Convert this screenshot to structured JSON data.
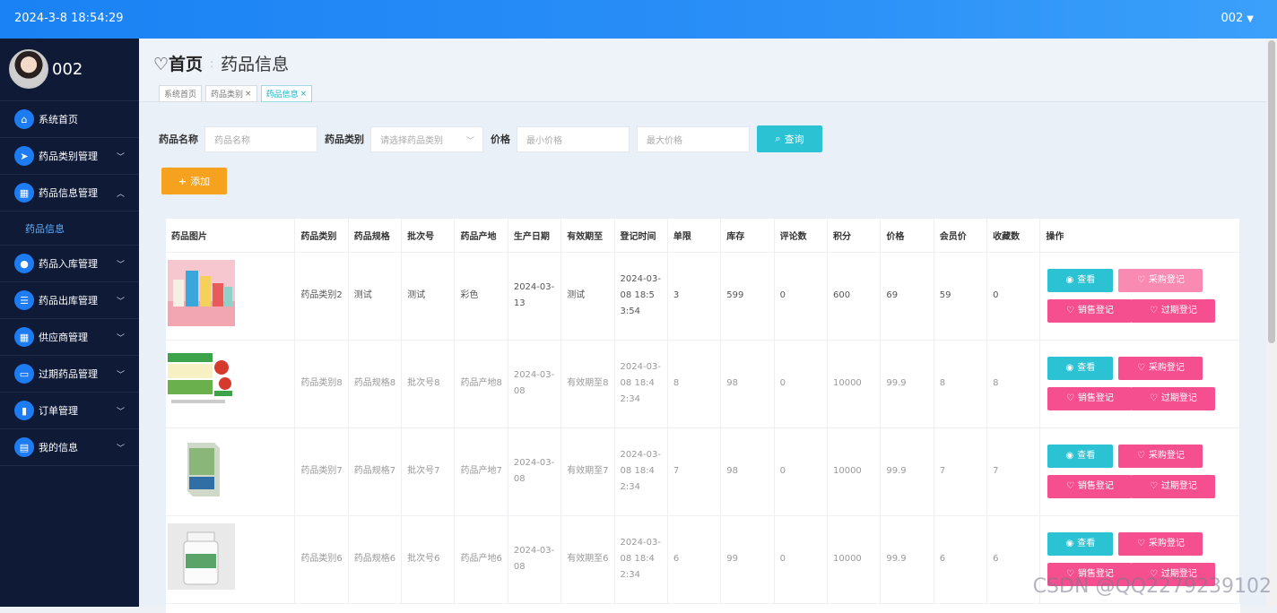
{
  "topbar": {
    "time": "2024-3-8 18:54:29",
    "user": "002"
  },
  "sidebar": {
    "username": "002",
    "items": [
      {
        "label": "系统首页",
        "icon": "home-icon",
        "glyph": "⌂",
        "chevron": ""
      },
      {
        "label": "药品类别管理",
        "icon": "send-icon",
        "glyph": "➤",
        "chevron": "﹀"
      },
      {
        "label": "药品信息管理",
        "icon": "grid-icon",
        "glyph": "▦",
        "chevron": "︿"
      },
      {
        "label": "药品入库管理",
        "icon": "pin-icon",
        "glyph": "●",
        "chevron": "﹀"
      },
      {
        "label": "药品出库管理",
        "icon": "sliders-icon",
        "glyph": "☰",
        "chevron": "﹀"
      },
      {
        "label": "供应商管理",
        "icon": "apps-icon",
        "glyph": "▦",
        "chevron": "﹀"
      },
      {
        "label": "过期药品管理",
        "icon": "monitor-icon",
        "glyph": "▭",
        "chevron": "﹀"
      },
      {
        "label": "订单管理",
        "icon": "chart-icon",
        "glyph": "▮",
        "chevron": "﹀"
      },
      {
        "label": "我的信息",
        "icon": "card-icon",
        "glyph": "▤",
        "chevron": "﹀"
      }
    ],
    "submenu": "药品信息"
  },
  "header": {
    "home": "首页",
    "current": "药品信息"
  },
  "tabs": [
    {
      "label": "系统首页",
      "closable": false
    },
    {
      "label": "药品类别",
      "closable": true
    },
    {
      "label": "药品信息",
      "closable": true
    }
  ],
  "search": {
    "name_label": "药品名称",
    "name_placeholder": "药品名称",
    "category_label": "药品类别",
    "category_placeholder": "请选择药品类别",
    "price_label": "价格",
    "min_placeholder": "最小价格",
    "max_placeholder": "最大价格",
    "button": "查询"
  },
  "add_button": "添加",
  "table": {
    "headers": [
      "药品图片",
      "药品类别",
      "药品规格",
      "批次号",
      "药品产地",
      "生产日期",
      "有效期至",
      "登记时间",
      "单限",
      "库存",
      "评论数",
      "积分",
      "价格",
      "会员价",
      "收藏数",
      "操作"
    ],
    "rows": [
      {
        "image": "product-box-photo",
        "category": "药品类别2",
        "spec": "测试",
        "batch": "测试",
        "origin": "彩色",
        "prod_date": "2024-03-13",
        "expiry": "测试",
        "reg_time": "2024-03-08 18:53:54",
        "limit": "3",
        "stock": "599",
        "comments": "0",
        "points": "600",
        "price": "69",
        "member_price": "59",
        "favorites": "0"
      },
      {
        "image": "weixiao-tablets-box",
        "category": "药品类别8",
        "spec": "药品规格8",
        "batch": "批次号8",
        "origin": "药品产地8",
        "prod_date": "2024-03-08",
        "expiry": "有效期至8",
        "reg_time": "2024-03-08 18:42:34",
        "limit": "8",
        "stock": "98",
        "comments": "0",
        "points": "10000",
        "price": "99.9",
        "member_price": "8",
        "favorites": "8"
      },
      {
        "image": "green-medicine-box",
        "category": "药品类别7",
        "spec": "药品规格7",
        "batch": "批次号7",
        "origin": "药品产地7",
        "prod_date": "2024-03-08",
        "expiry": "有效期至7",
        "reg_time": "2024-03-08 18:42:34",
        "limit": "7",
        "stock": "98",
        "comments": "0",
        "points": "10000",
        "price": "99.9",
        "member_price": "7",
        "favorites": "7"
      },
      {
        "image": "white-pill-bottle",
        "category": "药品类别6",
        "spec": "药品规格6",
        "batch": "批次号6",
        "origin": "药品产地6",
        "prod_date": "2024-03-08",
        "expiry": "有效期至6",
        "reg_time": "2024-03-08 18:42:34",
        "limit": "6",
        "stock": "99",
        "comments": "0",
        "points": "10000",
        "price": "99.9",
        "member_price": "6",
        "favorites": "6"
      }
    ],
    "actions": {
      "view": "查看",
      "purchase": "采购登记",
      "sale": "销售登记",
      "expired": "过期登记"
    }
  },
  "watermark": "CSDN @QQ2279239102"
}
